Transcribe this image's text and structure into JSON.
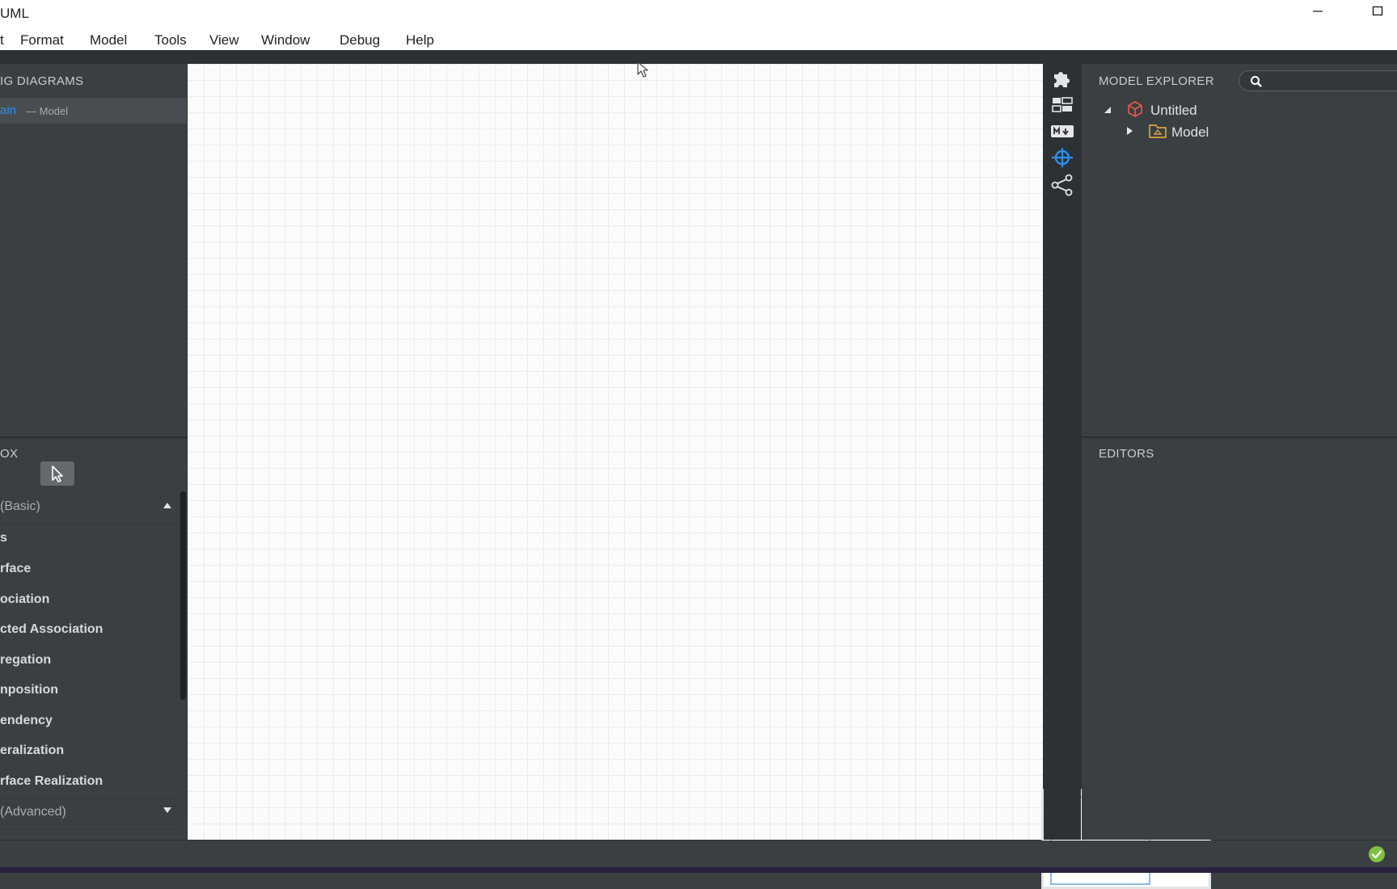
{
  "window": {
    "title": "UML",
    "minimize_icon": "minimize-icon",
    "maximize_icon": "maximize-icon"
  },
  "menu": [
    "t",
    "Format",
    "Model",
    "Tools",
    "View",
    "Window",
    "Debug",
    "Help"
  ],
  "working_diagrams": {
    "header": "IG DIAGRAMS",
    "items": [
      {
        "name": "ain",
        "suffix": "— Model"
      }
    ]
  },
  "toolbox": {
    "header": "OX",
    "basic_label": "(Basic)",
    "items": [
      "s",
      "rface",
      "ociation",
      "cted Association",
      "regation",
      "nposition",
      "endency",
      "eralization",
      "rface Realization"
    ],
    "advanced_label": "(Advanced)"
  },
  "side_toolbar": [
    "extensions-icon",
    "layout-icon",
    "markdown-icon",
    "target-icon",
    "share-icon"
  ],
  "model_explorer": {
    "header": "MODEL EXPLORER",
    "search_placeholder": "",
    "tree": [
      {
        "label": "Untitled",
        "icon": "project-cube-icon",
        "expanded": true
      },
      {
        "label": "Model",
        "icon": "model-package-icon",
        "expanded": false
      }
    ]
  },
  "editors": {
    "header": "EDITORS"
  },
  "status": {
    "icon": "check-circle-icon"
  },
  "colors": {
    "accent": "#2f8ff0",
    "panel": "#3a3f42",
    "canvas": "#fbfbfb",
    "project_icon": "#e8574a",
    "model_icon": "#d9a441",
    "status_ok": "#7fc241"
  }
}
